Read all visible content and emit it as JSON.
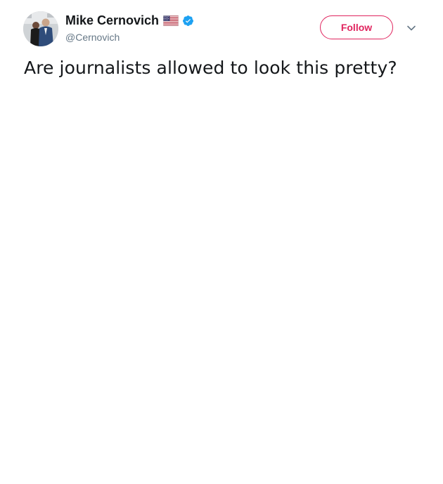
{
  "author": {
    "display_name": "Mike Cernovich",
    "handle": "@Cernovich",
    "flag_icon": "us-flag-icon",
    "verified_icon": "verified-badge-icon",
    "avatar_icon": "avatar-photo"
  },
  "actions": {
    "follow_label": "Follow",
    "more_icon": "chevron-down-icon"
  },
  "tweet": {
    "text": "Are journalists allowed to look this pretty?"
  },
  "colors": {
    "follow_accent": "#e0245e",
    "verified_blue": "#1da1f2",
    "handle_gray": "#657786",
    "text_dark": "#14171a"
  }
}
